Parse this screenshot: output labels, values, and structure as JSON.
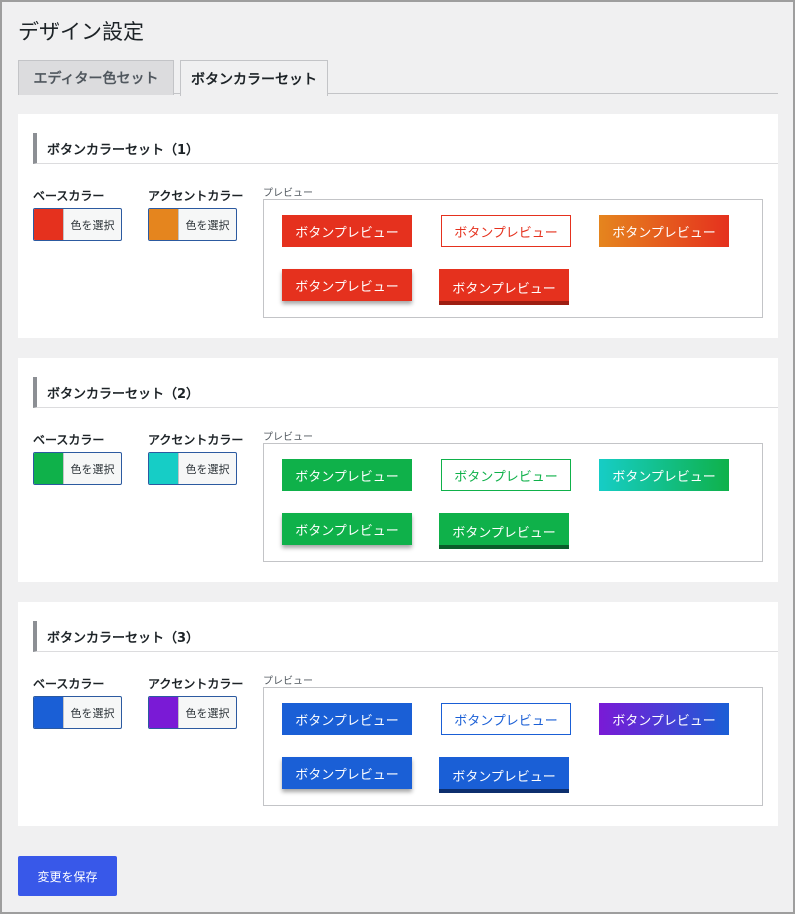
{
  "page_title": "デザイン設定",
  "tabs": [
    {
      "label": "エディター色セット",
      "active": false
    },
    {
      "label": "ボタンカラーセット",
      "active": true
    }
  ],
  "base_color_label": "ベースカラー",
  "accent_color_label": "アクセントカラー",
  "pick_color_label": "色を選択",
  "preview_label": "プレビュー",
  "preview_button_label": "ボタンプレビュー",
  "sets": [
    {
      "title": "ボタンカラーセット（1）",
      "base": "#e5311e",
      "accent": "#e5851e",
      "dark": "#9e1e12"
    },
    {
      "title": "ボタンカラーセット（2）",
      "base": "#0fb14a",
      "accent": "#16cdc6",
      "dark": "#0a5c2a"
    },
    {
      "title": "ボタンカラーセット（3）",
      "base": "#1a5fd6",
      "accent": "#7a1ad6",
      "dark": "#0d2f6e"
    }
  ],
  "save_button_label": "変更を保存"
}
